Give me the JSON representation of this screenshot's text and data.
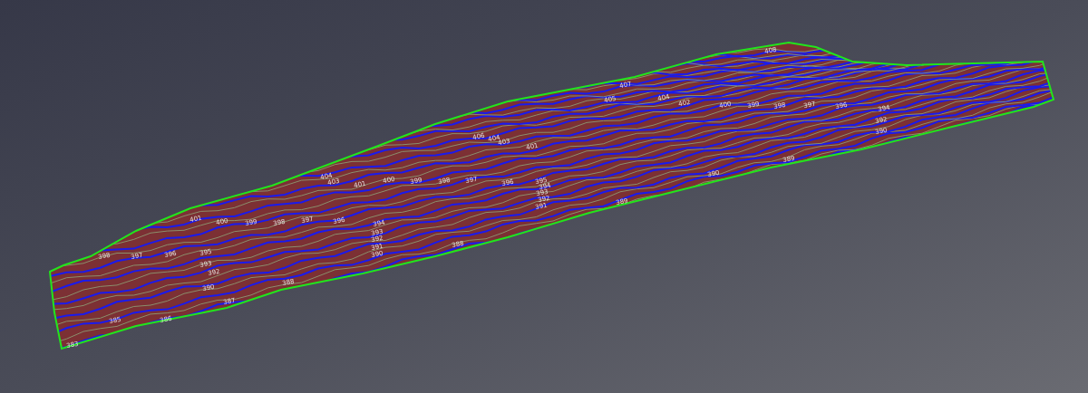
{
  "terrain_view": {
    "contour_labels": [
      "408",
      "407",
      "406",
      "405",
      "404",
      "404",
      "403",
      "402",
      "401",
      "400",
      "399",
      "398",
      "397",
      "396",
      "394",
      "392",
      "390",
      "404",
      "403",
      "401",
      "400",
      "399",
      "398",
      "397",
      "396",
      "395",
      "394",
      "393",
      "392",
      "391",
      "390",
      "389",
      "389",
      "401",
      "400",
      "399",
      "398",
      "397",
      "396",
      "394",
      "393",
      "392",
      "391",
      "390",
      "388",
      "398",
      "397",
      "396",
      "395",
      "393",
      "392",
      "390",
      "388",
      "387",
      "385",
      "386",
      "383"
    ]
  }
}
